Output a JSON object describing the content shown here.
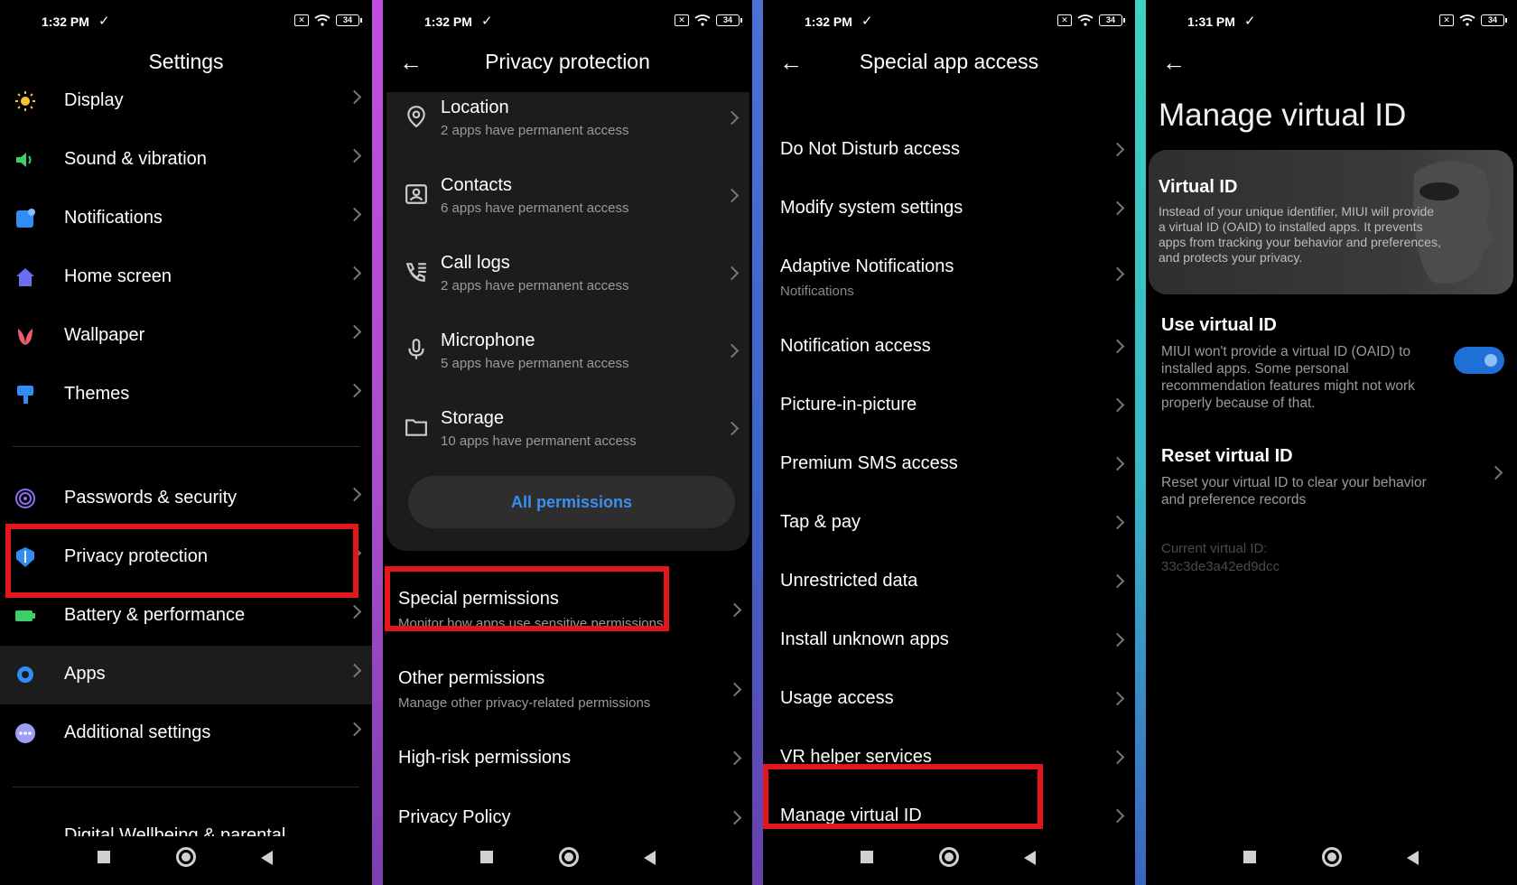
{
  "status": {
    "time_a": "1:32 PM",
    "time_b": "1:31 PM",
    "battery": "34"
  },
  "settings": {
    "title": "Settings",
    "items": [
      {
        "label": "Display"
      },
      {
        "label": "Sound & vibration"
      },
      {
        "label": "Notifications"
      },
      {
        "label": "Home screen"
      },
      {
        "label": "Wallpaper"
      },
      {
        "label": "Themes"
      },
      {
        "label": "Passwords & security"
      },
      {
        "label": "Privacy protection"
      },
      {
        "label": "Battery & performance"
      },
      {
        "label": "Apps"
      },
      {
        "label": "Additional settings"
      },
      {
        "label": "Digital Wellbeing & parental"
      }
    ]
  },
  "privacy": {
    "title": "Privacy protection",
    "permissions": [
      {
        "label": "Location",
        "sub": "2 apps have permanent access"
      },
      {
        "label": "Contacts",
        "sub": "6 apps have permanent access"
      },
      {
        "label": "Call logs",
        "sub": "2 apps have permanent access"
      },
      {
        "label": "Microphone",
        "sub": "5 apps have permanent access"
      },
      {
        "label": "Storage",
        "sub": "10 apps have permanent access"
      }
    ],
    "all_permissions": "All permissions",
    "others": [
      {
        "label": "Special permissions",
        "sub": "Monitor how apps use sensitive permissions"
      },
      {
        "label": "Other permissions",
        "sub": "Manage other privacy-related permissions"
      },
      {
        "label": "High-risk permissions",
        "sub": ""
      },
      {
        "label": "Privacy Policy",
        "sub": ""
      }
    ]
  },
  "special": {
    "title": "Special app access",
    "items": [
      {
        "label": "Do Not Disturb access",
        "sub": ""
      },
      {
        "label": "Modify system settings",
        "sub": ""
      },
      {
        "label": "Adaptive Notifications",
        "sub": "Notifications"
      },
      {
        "label": "Notification access",
        "sub": ""
      },
      {
        "label": "Picture-in-picture",
        "sub": ""
      },
      {
        "label": "Premium SMS access",
        "sub": ""
      },
      {
        "label": "Tap & pay",
        "sub": ""
      },
      {
        "label": "Unrestricted data",
        "sub": ""
      },
      {
        "label": "Install unknown apps",
        "sub": ""
      },
      {
        "label": "Usage access",
        "sub": ""
      },
      {
        "label": "VR helper services",
        "sub": ""
      },
      {
        "label": "Manage virtual ID",
        "sub": ""
      }
    ]
  },
  "virtual": {
    "title": "Manage virtual ID",
    "card_title": "Virtual ID",
    "card_text": "Instead of your unique identifier, MIUI will provide a virtual ID (OAID) to installed apps. It prevents apps from tracking your behavior and preferences, and protects your privacy.",
    "use_title": "Use virtual ID",
    "use_text": "MIUI won't provide a virtual ID (OAID) to installed apps. Some personal recommendation features might not work properly because of that.",
    "use_enabled": true,
    "reset_title": "Reset virtual ID",
    "reset_text": "Reset your virtual ID to clear your behavior and preference records",
    "current_label": "Current virtual ID:",
    "current_value": "33c3de3a42ed9dcc"
  },
  "colors": {
    "highlight": "#e3171b",
    "accent": "#3b8ff0",
    "toggle": "#1e6fd6"
  }
}
